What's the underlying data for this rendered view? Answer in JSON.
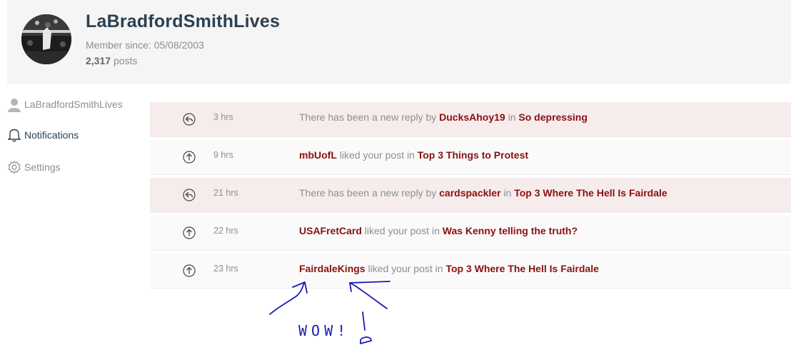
{
  "profile": {
    "username": "LaBradfordSmithLives",
    "member_since": "Member since: 05/08/2003",
    "post_count": "2,317",
    "posts_label": "posts"
  },
  "sidebar": {
    "items": [
      {
        "label": "LaBradfordSmithLives",
        "icon": "user-icon"
      },
      {
        "label": "Notifications",
        "icon": "bell-icon"
      },
      {
        "label": "Settings",
        "icon": "gear-icon"
      }
    ]
  },
  "notifications": [
    {
      "type": "reply",
      "time": "3 hrs",
      "pre": "There has been a new reply by ",
      "actor": "DucksAhoy19",
      "mid": " in ",
      "topic": "So depressing",
      "unread": true
    },
    {
      "type": "like",
      "time": "9 hrs",
      "pre": "",
      "actor": "mbUofL",
      "mid": " liked your post in ",
      "topic": "Top 3 Things to Protest",
      "unread": false
    },
    {
      "type": "reply",
      "time": "21 hrs",
      "pre": "There has been a new reply by ",
      "actor": "cardspackler",
      "mid": " in ",
      "topic": "Top 3 Where The Hell Is Fairdale",
      "unread": true
    },
    {
      "type": "like",
      "time": "22 hrs",
      "pre": "",
      "actor": "USAFretCard",
      "mid": " liked your post in ",
      "topic": "Was Kenny telling the truth?",
      "unread": false
    },
    {
      "type": "like",
      "time": "23 hrs",
      "pre": "",
      "actor": "FairdaleKings",
      "mid": " liked your post in ",
      "topic": "Top 3 Where The Hell Is Fairdale",
      "unread": false
    }
  ],
  "annotation": {
    "text": "WOW!",
    "color": "#1a1ab8"
  },
  "colors": {
    "link": "#8a1010",
    "unread_bg": "#f7ecec",
    "title": "#2d4050"
  }
}
